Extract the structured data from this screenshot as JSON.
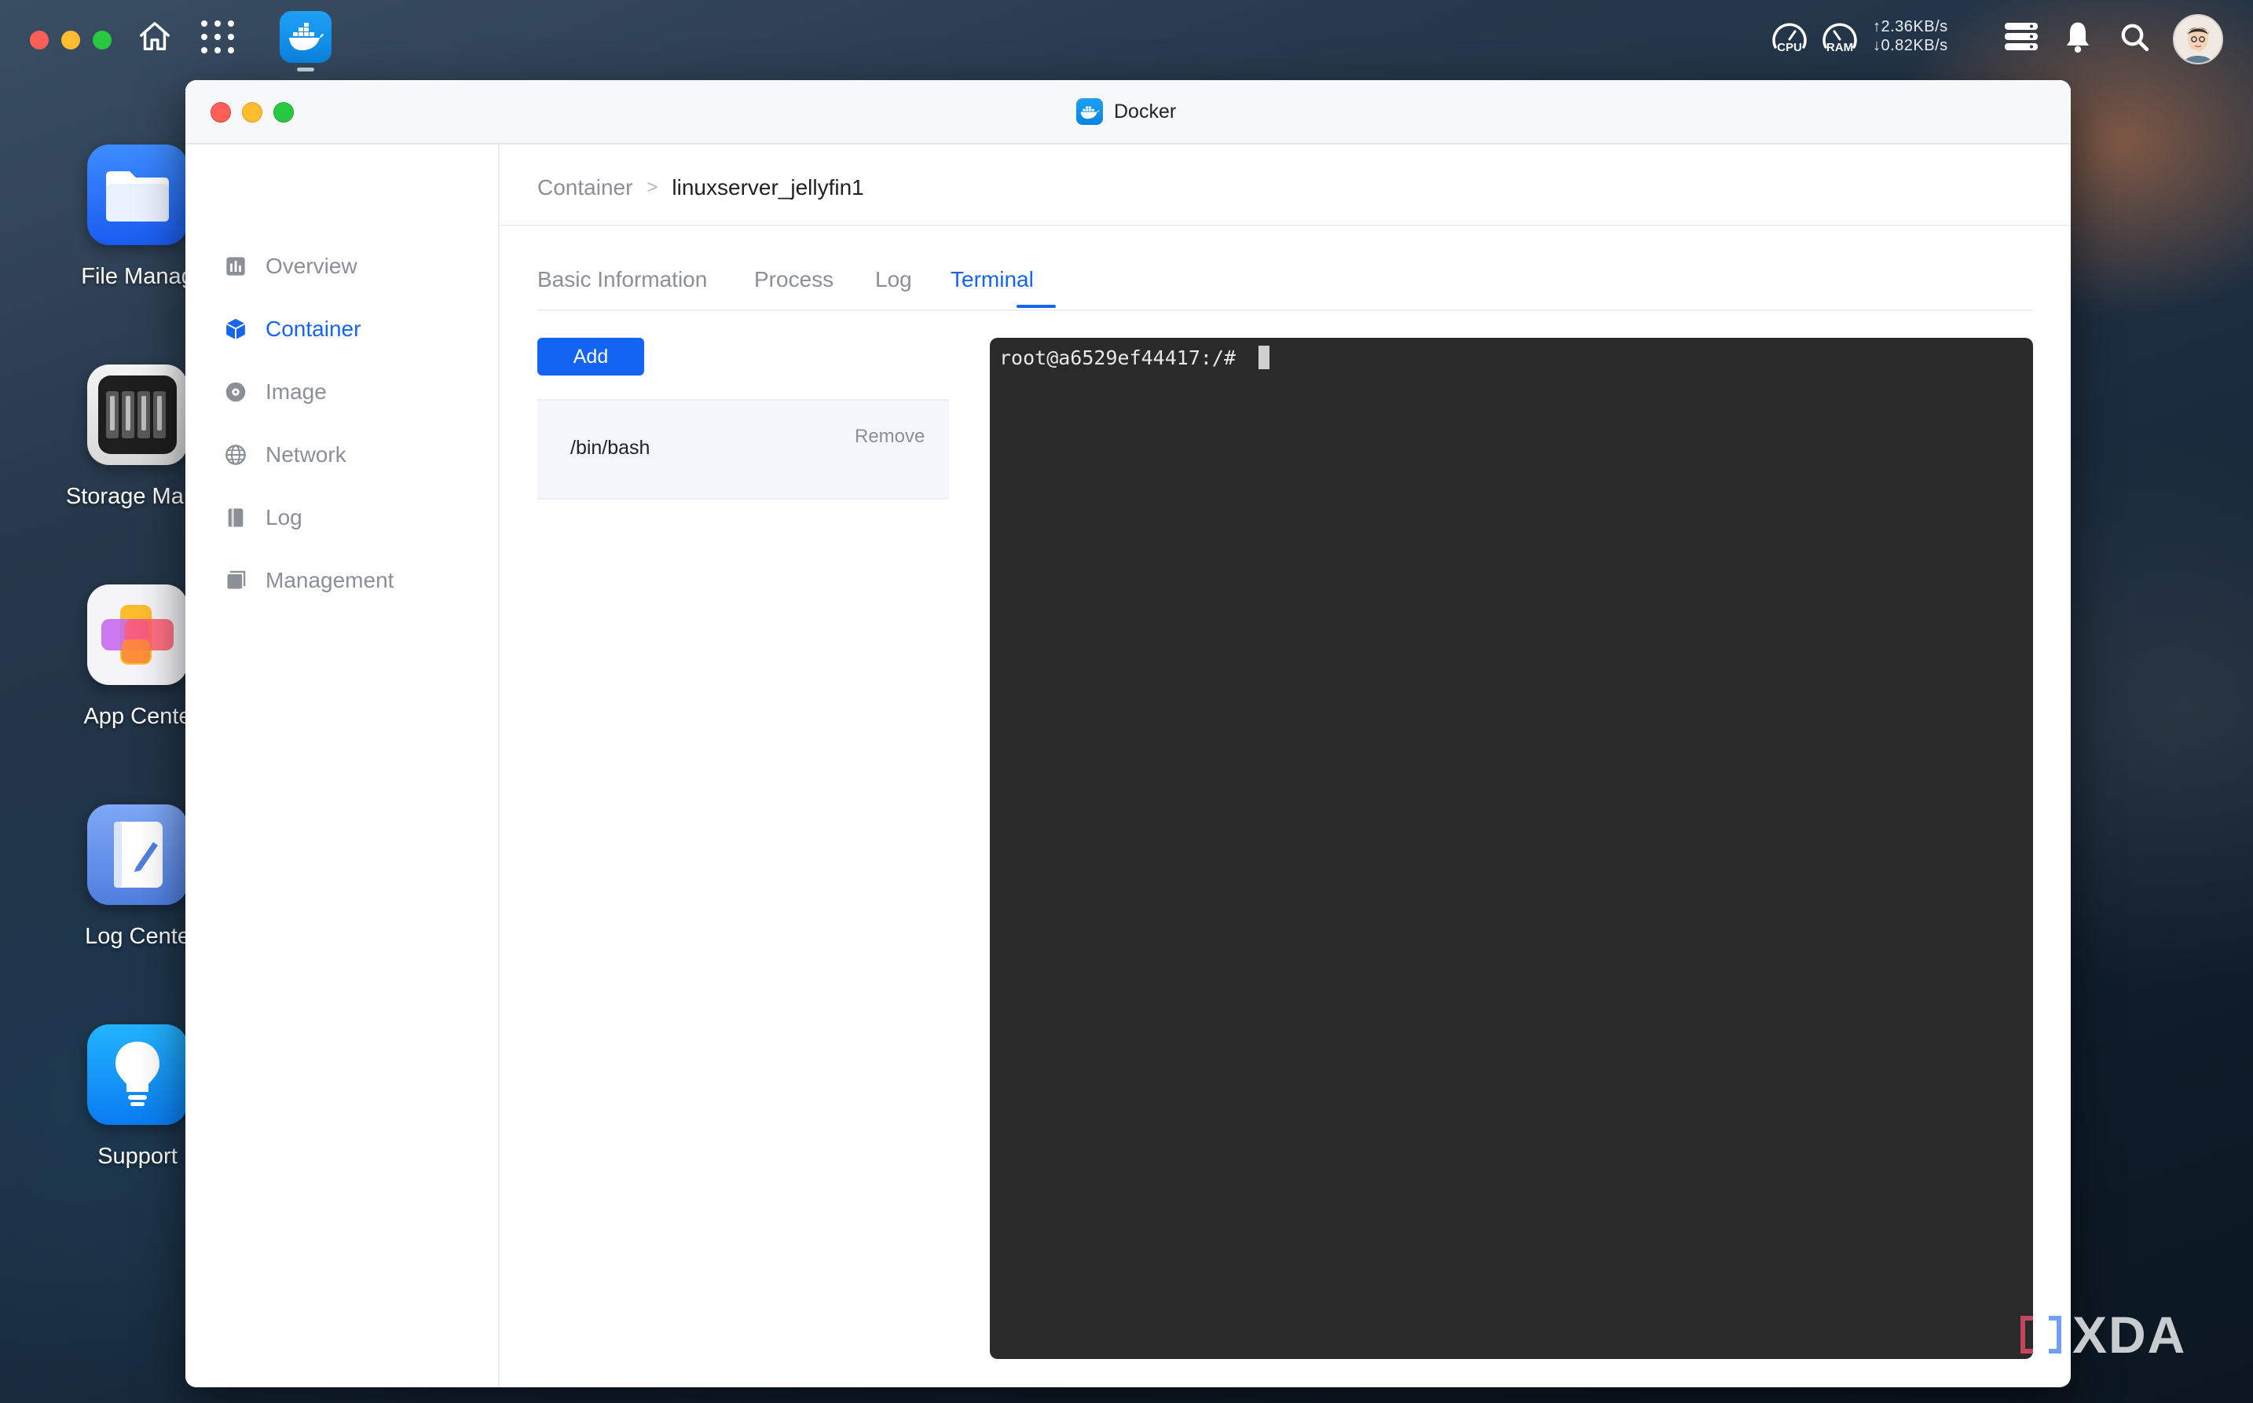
{
  "topbar": {
    "cpu_label": "CPU",
    "ram_label": "RAM",
    "upload_rate": "↑2.36KB/s",
    "download_rate": "↓0.82KB/s",
    "traffic_colors": [
      "#ff5f57",
      "#febc2e",
      "#28c840"
    ]
  },
  "desktop": {
    "icons": [
      {
        "label": "File Manag",
        "icon": "folder-icon"
      },
      {
        "label": "Storage Mana",
        "icon": "storage-icon"
      },
      {
        "label": "App Cente",
        "icon": "app-center-icon"
      },
      {
        "label": "Log Cente",
        "icon": "log-center-icon"
      },
      {
        "label": "Support",
        "icon": "lightbulb-icon"
      }
    ]
  },
  "window": {
    "title": "Docker",
    "accent_color": "#1565f0"
  },
  "sidebar": {
    "items": [
      {
        "label": "Overview",
        "icon": "chart-icon",
        "active": false
      },
      {
        "label": "Container",
        "icon": "cube-icon",
        "active": true
      },
      {
        "label": "Image",
        "icon": "disc-icon",
        "active": false
      },
      {
        "label": "Network",
        "icon": "globe-icon",
        "active": false
      },
      {
        "label": "Log",
        "icon": "book-icon",
        "active": false
      },
      {
        "label": "Management",
        "icon": "stack-icon",
        "active": false
      }
    ]
  },
  "breadcrumb": {
    "parent": "Container",
    "separator": ">",
    "current": "linuxserver_jellyfin1"
  },
  "tabs": [
    {
      "label": "Basic Information",
      "active": false
    },
    {
      "label": "Process",
      "active": false
    },
    {
      "label": "Log",
      "active": false
    },
    {
      "label": "Terminal",
      "active": true
    }
  ],
  "terminal_panel": {
    "add_label": "Add",
    "sessions": [
      {
        "command": "/bin/bash",
        "remove_label": "Remove"
      }
    ],
    "prompt": "root@a6529ef44417:/# "
  },
  "watermark": {
    "text": "XDA"
  }
}
